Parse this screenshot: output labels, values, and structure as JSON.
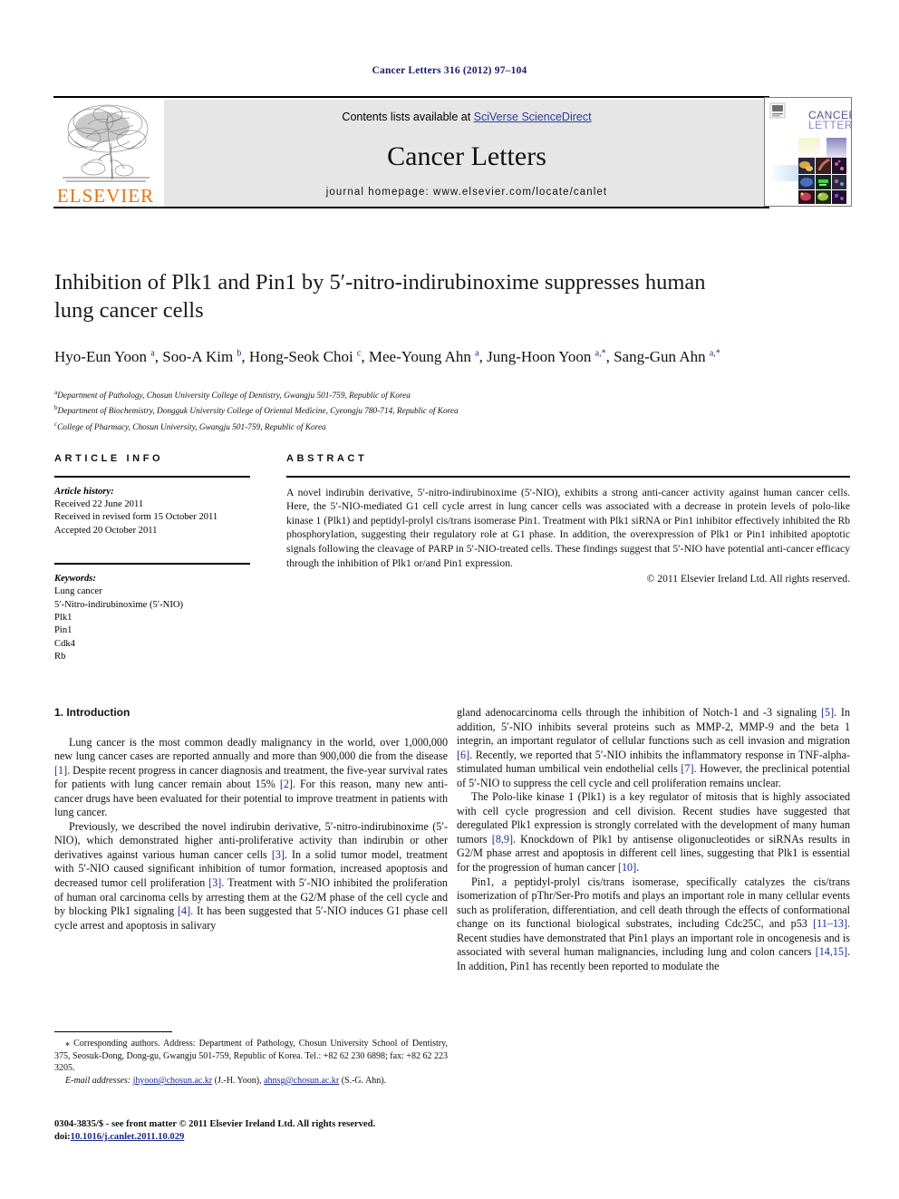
{
  "running_head": "Cancer Letters 316 (2012) 97–104",
  "masthead": {
    "contents_prefix": "Contents lists available at ",
    "sciencedirect_link": "SciVerse ScienceDirect",
    "journal_title": "Cancer Letters",
    "homepage": "journal homepage: www.elsevier.com/locate/canlet",
    "publisher": "ELSEVIER",
    "cover_title_line1": "CANCER",
    "cover_title_line2": "LETTERS",
    "link_color": "#2b3c9e",
    "elsevier_orange": "#e8710a"
  },
  "article": {
    "title": "Inhibition of Plk1 and Pin1 by 5′-nitro-indirubinoxime suppresses human lung cancer cells",
    "authors_html": "Hyo-Eun Yoon <sup>a</sup>, Soo-A Kim <sup>b</sup>, Hong-Seok Choi <sup>c</sup>, Mee-Young Ahn <sup>a</sup>, Jung-Hoon Yoon <sup>a,*</sup>, Sang-Gun Ahn <sup>a,*</sup>",
    "affiliations": [
      {
        "marker": "a",
        "text": "Department of Pathology, Chosun University College of Dentistry, Gwangju 501-759, Republic of Korea"
      },
      {
        "marker": "b",
        "text": "Department of Biochemistry, Dongguk University College of Oriental Medicine, Cyeongju 780-714, Republic of Korea"
      },
      {
        "marker": "c",
        "text": "College of Pharmacy, Chosun University, Gwangju 501-759, Republic of Korea"
      }
    ]
  },
  "article_info": {
    "heading": "ARTICLE INFO",
    "history_label": "Article history:",
    "history": [
      "Received 22 June 2011",
      "Received in revised form 15 October 2011",
      "Accepted 20 October 2011"
    ],
    "keywords_label": "Keywords:",
    "keywords": [
      "Lung cancer",
      "5′-Nitro-indirubinoxime (5′-NIO)",
      "Plk1",
      "Pin1",
      "Cdk4",
      "Rb"
    ]
  },
  "abstract": {
    "heading": "ABSTRACT",
    "body": "A novel indirubin derivative, 5′-nitro-indirubinoxime (5′-NIO), exhibits a strong anti-cancer activity against human cancer cells. Here, the 5′-NIO-mediated G1 cell cycle arrest in lung cancer cells was associated with a decrease in protein levels of polo-like kinase 1 (Plk1) and peptidyl-prolyl cis/trans isomerase Pin1. Treatment with Plk1 siRNA or Pin1 inhibitor effectively inhibited the Rb phosphorylation, suggesting their regulatory role at G1 phase. In addition, the overexpression of Plk1 or Pin1 inhibited apoptotic signals following the cleavage of PARP in 5′-NIO-treated cells. These findings suggest that 5′-NIO have potential anti-cancer efficacy through the inhibition of Plk1 or/and Pin1 expression.",
    "copyright": "© 2011 Elsevier Ireland Ltd. All rights reserved."
  },
  "introduction": {
    "heading": "1. Introduction",
    "left_paragraphs": [
      "Lung cancer is the most common deadly malignancy in the world, over 1,000,000 new lung cancer cases are reported annually and more than 900,000 die from the disease [1]. Despite recent progress in cancer diagnosis and treatment, the five-year survival rates for patients with lung cancer remain about 15% [2]. For this reason, many new anti-cancer drugs have been evaluated for their potential to improve treatment in patients with lung cancer.",
      "Previously, we described the novel indirubin derivative, 5′-nitro-indirubinoxime (5′-NIO), which demonstrated higher anti-proliferative activity than indirubin or other derivatives against various human cancer cells [3]. In a solid tumor model, treatment with 5′-NIO caused significant inhibition of tumor formation, increased apoptosis and decreased tumor cell proliferation [3]. Treatment with 5′-NIO inhibited the proliferation of human oral carcinoma cells by arresting them at the G2/M phase of the cell cycle and by blocking Plk1 signaling [4]. It has been suggested that 5′-NIO induces G1 phase cell cycle arrest and apoptosis in salivary"
    ],
    "right_paragraphs": [
      "gland adenocarcinoma cells through the inhibition of Notch-1 and -3 signaling [5]. In addition, 5′-NIO inhibits several proteins such as MMP-2, MMP-9 and the beta 1 integrin, an important regulator of cellular functions such as cell invasion and migration [6]. Recently, we reported that 5′-NIO inhibits the inflammatory response in TNF-alpha-stimulated human umbilical vein endothelial cells [7]. However, the preclinical potential of 5′-NIO to suppress the cell cycle and cell proliferation remains unclear.",
      "The Polo-like kinase 1 (Plk1) is a key regulator of mitosis that is highly associated with cell cycle progression and cell division. Recent studies have suggested that deregulated Plk1 expression is strongly correlated with the development of many human tumors [8,9]. Knockdown of Plk1 by antisense oligonucleotides or siRNAs results in G2/M phase arrest and apoptosis in different cell lines, suggesting that Plk1 is essential for the progression of human cancer [10].",
      "Pin1, a peptidyl-prolyl cis/trans isomerase, specifically catalyzes the cis/trans isomerization of pThr/Ser-Pro motifs and plays an important role in many cellular events such as proliferation, differentiation, and cell death through the effects of conformational change on its functional biological substrates, including Cdc25C, and p53 [11–13]. Recent studies have demonstrated that Pin1 plays an important role in oncogenesis and is associated with several human malignancies, including lung and colon cancers [14,15]. In addition, Pin1 has recently been reported to modulate the"
    ]
  },
  "footnotes": {
    "corresponding": "⁎ Corresponding authors. Address: Department of Pathology, Chosun University School of Dentistry, 375, Seosuk-Dong, Dong-gu, Gwangju 501-759, Republic of Korea. Tel.: +82 62 230 6898; fax: +82 62 223 3205.",
    "email_label": "E-mail addresses:",
    "email_1": "jhyoon@chosun.ac.kr",
    "email_1_owner": "(J.-H. Yoon),",
    "email_2": "ahnsg@chosun.ac.kr",
    "email_2_owner": "(S.-G. Ahn).",
    "issn_line": "0304-3835/$ - see front matter © 2011 Elsevier Ireland Ltd. All rights reserved.",
    "doi_label": "doi:",
    "doi_value": "10.1016/j.canlet.2011.10.029"
  }
}
